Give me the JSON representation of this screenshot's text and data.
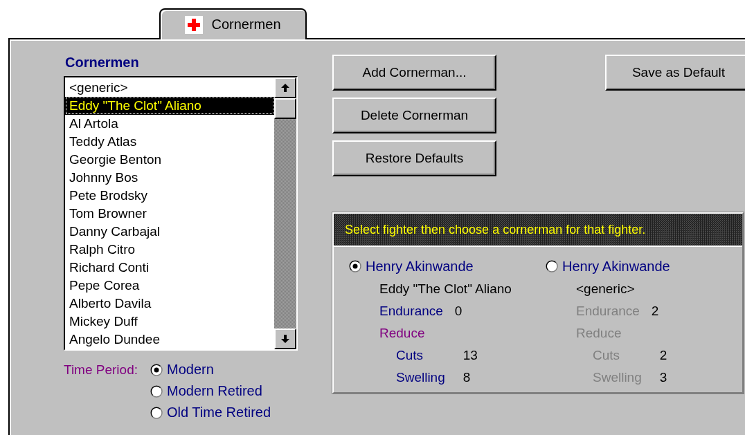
{
  "tab": {
    "label": "Cornermen",
    "selected": true
  },
  "list": {
    "heading": "Cornermen",
    "items": [
      {
        "name": "<generic>",
        "selected": false
      },
      {
        "name": "Eddy \"The Clot\" Aliano",
        "selected": true
      },
      {
        "name": "Al Artola",
        "selected": false
      },
      {
        "name": "Teddy Atlas",
        "selected": false
      },
      {
        "name": "Georgie Benton",
        "selected": false
      },
      {
        "name": "Johnny Bos",
        "selected": false
      },
      {
        "name": "Pete Brodsky",
        "selected": false
      },
      {
        "name": "Tom Browner",
        "selected": false
      },
      {
        "name": "Danny Carbajal",
        "selected": false
      },
      {
        "name": "Ralph Citro",
        "selected": false
      },
      {
        "name": "Richard Conti",
        "selected": false
      },
      {
        "name": "Pepe Corea",
        "selected": false
      },
      {
        "name": "Alberto Davila",
        "selected": false
      },
      {
        "name": "Mickey Duff",
        "selected": false
      },
      {
        "name": "Angelo Dundee",
        "selected": false
      }
    ]
  },
  "time_period": {
    "label": "Time Period:",
    "options": [
      {
        "label": "Modern",
        "selected": true
      },
      {
        "label": "Modern Retired",
        "selected": false
      },
      {
        "label": "Old Time Retired",
        "selected": false
      }
    ]
  },
  "buttons": [
    "Add Cornerman...",
    "Delete Cornerman",
    "Restore Defaults"
  ],
  "save_button": "Save as Default",
  "assignment": {
    "instruction": "Select fighter then choose a cornerman for that fighter.",
    "fighters": [
      {
        "name": "Henry Akinwande",
        "selected": true,
        "cornerman": "Eddy \"The Clot\" Aliano",
        "endurance_label": "Endurance",
        "endurance": "0",
        "reduce_label": "Reduce",
        "cuts_label": "Cuts",
        "cuts": "13",
        "swelling_label": "Swelling",
        "swelling": "8"
      },
      {
        "name": "Henry Akinwande",
        "selected": false,
        "cornerman": "<generic>",
        "endurance_label": "Endurance",
        "endurance": "2",
        "reduce_label": "Reduce",
        "cuts_label": "Cuts",
        "cuts": "2",
        "swelling_label": "Swelling",
        "swelling": "3"
      }
    ]
  }
}
